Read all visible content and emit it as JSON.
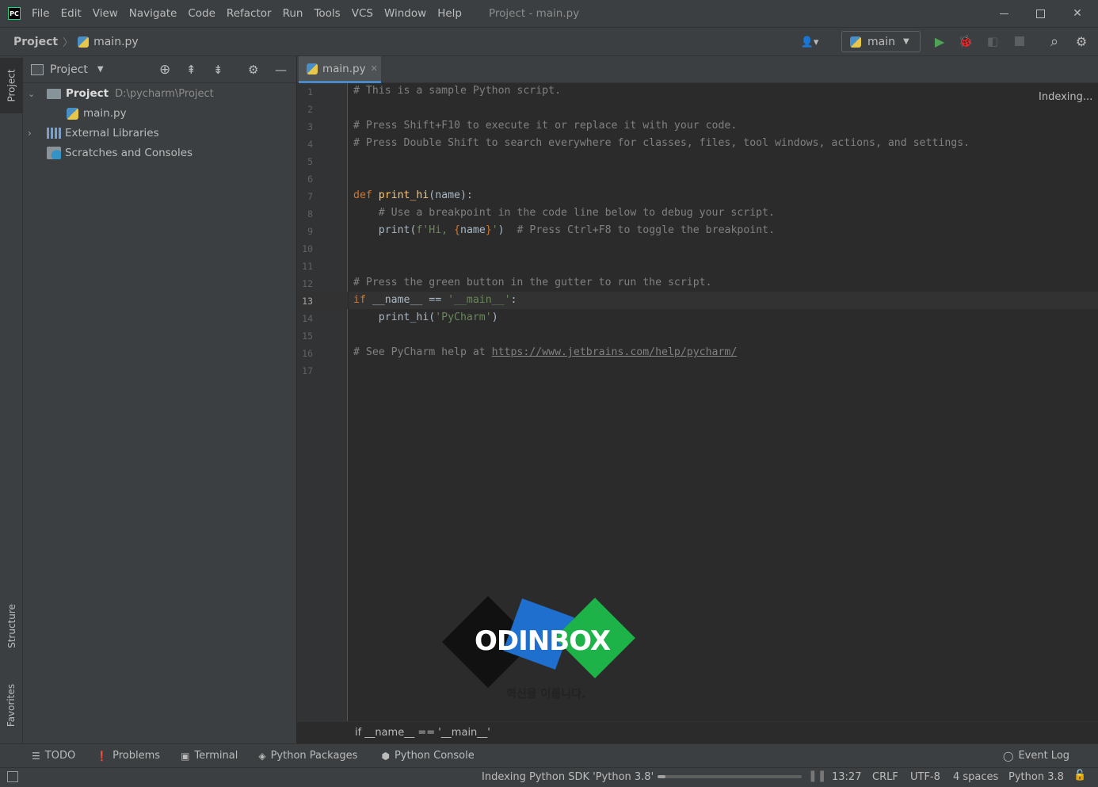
{
  "titlebar": {
    "menus": [
      "File",
      "Edit",
      "View",
      "Navigate",
      "Code",
      "Refactor",
      "Run",
      "Tools",
      "VCS",
      "Window",
      "Help"
    ],
    "window_title": "Project - main.py"
  },
  "navbar": {
    "crumbs": [
      "Project",
      "main.py"
    ],
    "run_config": "main"
  },
  "left_strip": {
    "project": "Project",
    "structure": "Structure",
    "favorites": "Favorites"
  },
  "project_panel": {
    "header": "Project",
    "tree": [
      {
        "label": "Project",
        "path": "D:\\pycharm\\Project"
      },
      {
        "label": "main.py"
      },
      {
        "label": "External Libraries"
      },
      {
        "label": "Scratches and Consoles"
      }
    ]
  },
  "editor": {
    "tab": "main.py",
    "status": "Indexing...",
    "breadcrumb": "if __name__ == '__main__'",
    "current_line": 13,
    "line_numbers": [
      "1",
      "2",
      "3",
      "4",
      "5",
      "6",
      "7",
      "8",
      "9",
      "10",
      "11",
      "12",
      "13",
      "14",
      "15",
      "16",
      "17"
    ]
  },
  "logo": {
    "name": "ODINBOX",
    "tagline": "혁신을 이룹니다."
  },
  "bottom_tabs": [
    "TODO",
    "Problems",
    "Terminal",
    "Python Packages",
    "Python Console"
  ],
  "event_log": "Event Log",
  "statusbar": {
    "indexing": "Indexing Python SDK 'Python 3.8'",
    "position": "13:27",
    "line_sep": "CRLF",
    "encoding": "UTF-8",
    "indent": "4 spaces",
    "interpreter": "Python 3.8"
  }
}
